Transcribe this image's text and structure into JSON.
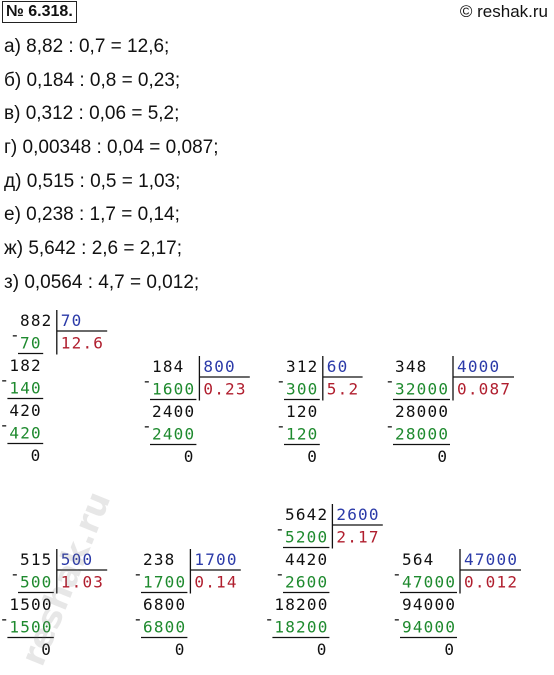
{
  "problem_number": "№ 6.318.",
  "copyright": "© reshak.ru",
  "equations": [
    "а) 8,82 : 0,7 = 12,6;",
    "б) 0,184 : 0,8 = 0,23;",
    "в) 0,312 : 0,06 = 5,2;",
    "г) 0,00348 : 0,04 = 0,087;",
    "д) 0,515 : 0,5 = 1,03;",
    "е) 0,238 : 1,7 = 0,14;",
    "ж) 5,642 : 2,6 = 2,17;",
    "з) 0,0564 : 4,7 = 0,012;"
  ],
  "watermark": "reshak.ru",
  "colors": {
    "divisor": "#2b3aa8",
    "quotient": "#b01e2e",
    "subtrahend": "#1e8a2e",
    "text": "#111111"
  },
  "divisions": [
    {
      "dividend": "882",
      "divisor": "70",
      "quotient": "12.6",
      "steps": [
        {
          "sub": "70",
          "rem": "182"
        },
        {
          "sub": "140",
          "rem": "420"
        },
        {
          "sub": "420",
          "rem": "0"
        }
      ]
    },
    {
      "dividend": "184",
      "divisor": "800",
      "quotient": "0.23",
      "steps": [
        {
          "sub": "1600",
          "rem": "2400"
        },
        {
          "sub": "2400",
          "rem": "0"
        }
      ]
    },
    {
      "dividend": "312",
      "divisor": "60",
      "quotient": "5.2",
      "steps": [
        {
          "sub": "300",
          "rem": "120"
        },
        {
          "sub": "120",
          "rem": "0"
        }
      ]
    },
    {
      "dividend": "348",
      "divisor": "4000",
      "quotient": "0.087",
      "steps": [
        {
          "sub": "32000",
          "rem": "28000"
        },
        {
          "sub": "28000",
          "rem": "0"
        }
      ]
    },
    {
      "dividend": "515",
      "divisor": "500",
      "quotient": "1.03",
      "steps": [
        {
          "sub": "500",
          "rem": "1500"
        },
        {
          "sub": "1500",
          "rem": "0"
        }
      ]
    },
    {
      "dividend": "238",
      "divisor": "1700",
      "quotient": "0.14",
      "steps": [
        {
          "sub": "1700",
          "rem": "6800"
        },
        {
          "sub": "6800",
          "rem": "0"
        }
      ]
    },
    {
      "dividend": "5642",
      "divisor": "2600",
      "quotient": "2.17",
      "steps": [
        {
          "sub": "5200",
          "rem": "4420"
        },
        {
          "sub": "2600",
          "rem": "18200"
        },
        {
          "sub": "18200",
          "rem": "0"
        }
      ]
    },
    {
      "dividend": "564",
      "divisor": "47000",
      "quotient": "0.012",
      "steps": [
        {
          "sub": "47000",
          "rem": "94000"
        },
        {
          "sub": "94000",
          "rem": "0"
        }
      ]
    }
  ]
}
